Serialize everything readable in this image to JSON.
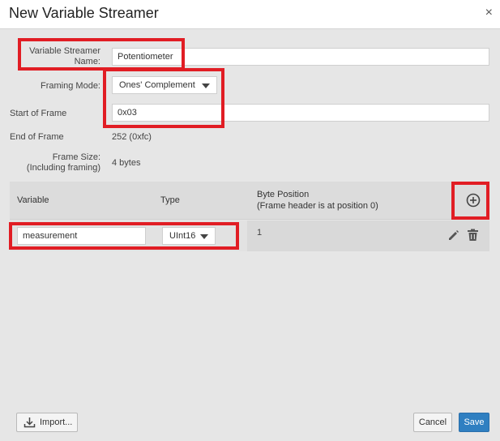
{
  "dialog": {
    "title": "New Variable Streamer",
    "close_label": "×"
  },
  "form": {
    "name_label": "Variable Streamer Name:",
    "name_value": "Potentiometer",
    "framing_mode_label": "Framing Mode:",
    "framing_mode_value": "Ones' Complement",
    "start_of_frame_label": "Start of Frame",
    "start_of_frame_value": "0x03",
    "end_of_frame_label": "End of Frame",
    "end_of_frame_value": "252 (0xfc)",
    "frame_size_label_line1": "Frame Size:",
    "frame_size_label_line2": "(Including framing)",
    "frame_size_value": "4 bytes"
  },
  "table": {
    "headers": {
      "variable": "Variable",
      "type": "Type",
      "byte_position_line1": "Byte Position",
      "byte_position_line2": "(Frame header is at position 0)"
    },
    "rows": [
      {
        "variable": "measurement",
        "type": "UInt16",
        "byte_position": "1"
      }
    ]
  },
  "footer": {
    "import_label": "Import...",
    "cancel_label": "Cancel",
    "save_label": "Save"
  },
  "colors": {
    "highlight": "#e11d24",
    "primary": "#2f7fc1"
  },
  "icons": {
    "add": "add-circle-icon",
    "edit": "pencil-icon",
    "delete": "trash-icon",
    "import": "download-icon",
    "close": "close-icon",
    "dropdown": "chevron-down-icon"
  }
}
